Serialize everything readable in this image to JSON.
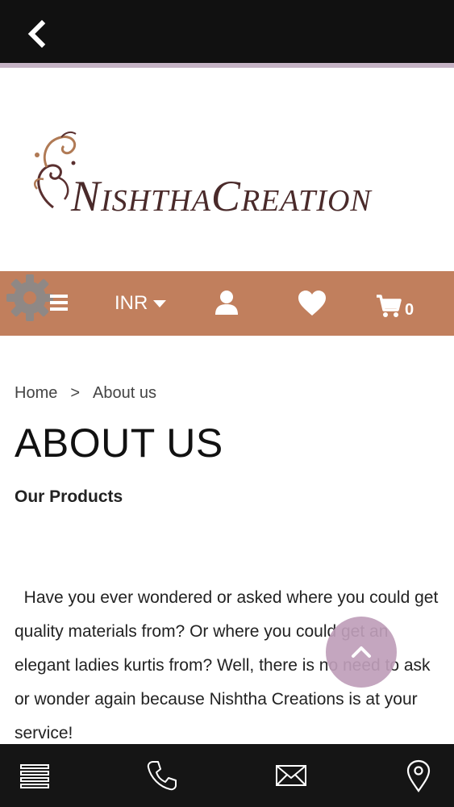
{
  "topbar": {
    "back_icon": "chevron-left-icon"
  },
  "brand": {
    "name_part1_initial": "N",
    "name_part1_rest": "ISHTHA",
    "name_part2_initial": "C",
    "name_part2_rest": "REATION"
  },
  "navbar": {
    "currency": "INR",
    "cart_count": "0",
    "icons": [
      "gear-icon",
      "menu-icon",
      "caret-down-icon",
      "user-icon",
      "heart-icon",
      "cart-icon"
    ]
  },
  "breadcrumb": {
    "home": "Home",
    "separator": ">",
    "current": "About us"
  },
  "page": {
    "title": "ABOUT US",
    "section_title": "Our Products",
    "paragraph": "  Have you ever wondered or asked where you could get quality materials from? Or where you could get an elegant ladies kurtis from? Well, there is no need to ask or wonder again because Nishtha Creations is at your service!"
  },
  "bottombar": {
    "icons": [
      "list-icon",
      "phone-icon",
      "mail-icon",
      "location-pin-icon"
    ]
  },
  "colors": {
    "navbar": "#c17f5d",
    "topbar": "#111111",
    "strip": "#c6b3c5",
    "scroll_button": "#bf9eba"
  }
}
